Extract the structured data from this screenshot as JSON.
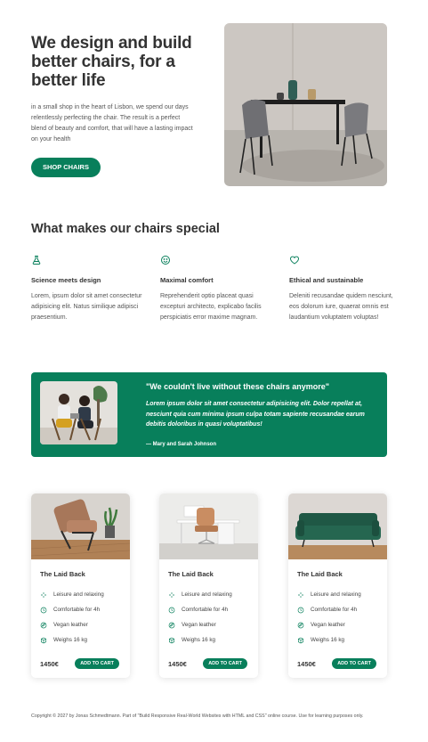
{
  "hero": {
    "title": "We design and build better chairs, for a better life",
    "description": "in a small shop in the heart of Lisbon, we spend our days relentlessly perfecting the chair. The result is a perfect blend of beauty and comfort, that will have a lasting impact on your health",
    "cta_label": "SHOP CHAIRS"
  },
  "features": {
    "title": "What makes our chairs special",
    "items": [
      {
        "icon": "flask-icon",
        "title": "Science meets design",
        "text": "Lorem, ipsum dolor sit amet consectetur adipisicing elit. Natus similique adipisci praesentium."
      },
      {
        "icon": "smile-icon",
        "title": "Maximal comfort",
        "text": "Reprehenderit optio placeat quasi excepturi architecto, explicabo facilis perspiciatis error maxime magnam."
      },
      {
        "icon": "heart-icon",
        "title": "Ethical and sustainable",
        "text": "Deleniti recusandae quidem nesciunt, eos dolorum iure, quaerat omnis est laudantium voluptatem voluptas!"
      }
    ]
  },
  "testimonial": {
    "quote": "\"We couldn't live without these chairs anymore\"",
    "body": "Lorem ipsum dolor sit amet consectetur adipisicing elit. Dolor repellat at, nesciunt quia cum minima ipsum culpa totam sapiente recusandae earum debitis doloribus in quasi voluptatibus!",
    "author": "— Mary and Sarah Johnson"
  },
  "products": [
    {
      "title": "The Laid Back",
      "price": "1450€",
      "cta": "ADD TO CART",
      "attributes": [
        "Leisure and relaxing",
        "Comfortable for 4h",
        "Vegan leather",
        "Weighs 16 kg"
      ]
    },
    {
      "title": "The Laid Back",
      "price": "1450€",
      "cta": "ADD TO CART",
      "attributes": [
        "Leisure and relaxing",
        "Comfortable for 4h",
        "Vegan leather",
        "Weighs 16 kg"
      ]
    },
    {
      "title": "The Laid Back",
      "price": "1450€",
      "cta": "ADD TO CART",
      "attributes": [
        "Leisure and relaxing",
        "Comfortable for 4h",
        "Vegan leather",
        "Weighs 16 kg"
      ]
    }
  ],
  "attribute_icons": [
    "sparkles-icon",
    "clock-icon",
    "leaf-icon",
    "box-icon"
  ],
  "footer": {
    "text": "Copyright © 2027 by Jonas Schmedtmann. Part of \"Build Responsive Real-World Websites with HTML and CSS\" online course. Use for learning purposes only."
  },
  "colors": {
    "accent": "#087f5b",
    "text": "#333333"
  }
}
